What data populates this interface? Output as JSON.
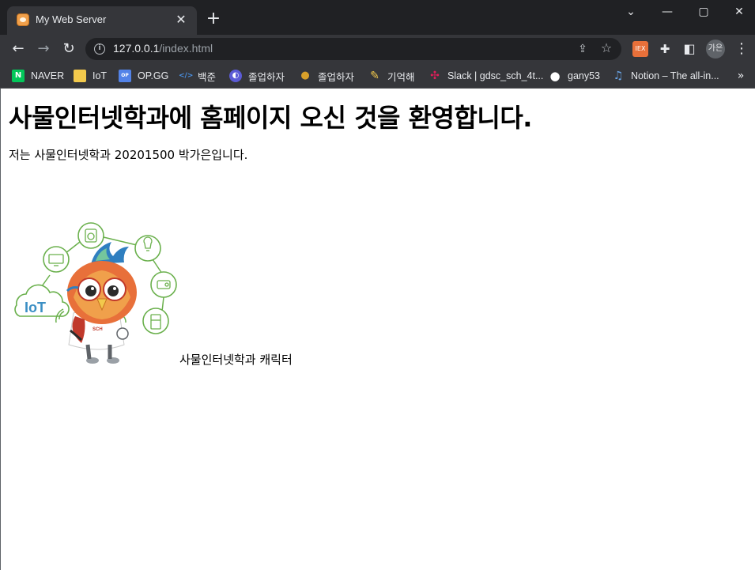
{
  "tab": {
    "title": "My Web Server",
    "close_glyph": "✕",
    "new_tab_glyph": "+"
  },
  "window_controls": {
    "minimize": "—",
    "maximize": "▢",
    "close": "✕",
    "dropdown": "⌄"
  },
  "toolbar": {
    "back": "←",
    "forward": "→",
    "reload": "↻",
    "url_host": "127.0.0.1",
    "url_path": "/index.html",
    "info_glyph": "i",
    "share_glyph": "⇪",
    "star_glyph": "☆",
    "profile_label": "가은",
    "menu_glyph": "⋮",
    "extensions": [
      {
        "name": "extension-red-icon",
        "glyph": "IEX",
        "color": "#e8703a"
      },
      {
        "name": "puzzle-icon",
        "glyph": "✚",
        "color": "#35363a"
      },
      {
        "name": "sidepanel-icon",
        "glyph": "◧",
        "color": "#35363a"
      }
    ]
  },
  "bookmarks": [
    {
      "label": "NAVER",
      "icon": "naver-icon",
      "color": "#03c75a",
      "glyph": "N"
    },
    {
      "label": "IoT",
      "icon": "folder-icon",
      "color": "#f2c94c",
      "glyph": ""
    },
    {
      "label": "OP.GG",
      "icon": "opgg-icon",
      "color": "#5383e8",
      "glyph": "OP"
    },
    {
      "label": "백준",
      "icon": "code-icon",
      "color": "#35363a",
      "glyph": "</>"
    },
    {
      "label": "졸업하자",
      "icon": "chat-icon",
      "color": "#5b5bd6",
      "glyph": "◐"
    },
    {
      "label": "졸업하자",
      "icon": "medal-icon",
      "color": "#d9a02a",
      "glyph": "●"
    },
    {
      "label": "기억해",
      "icon": "pencil-icon",
      "color": "#f2c94c",
      "glyph": "✎"
    },
    {
      "label": "Slack | gdsc_sch_4t...",
      "icon": "slack-icon",
      "color": "#35363a",
      "glyph": "✣"
    },
    {
      "label": "gany53",
      "icon": "github-icon",
      "color": "#ffffff",
      "glyph": "●"
    },
    {
      "label": "Notion – The all-in...",
      "icon": "music-icon",
      "color": "#35363a",
      "glyph": "♫"
    }
  ],
  "bookmarks_more": "»",
  "content": {
    "heading": "사물인터넷학과에 홈페이지 오신 것을 환영합니다.",
    "intro": "저는 사물인터넷학과 20201500 박가은입니다.",
    "image_text": "IoT",
    "image_badge": "SCH",
    "caption": "사물인터넷학과 캐릭터"
  }
}
